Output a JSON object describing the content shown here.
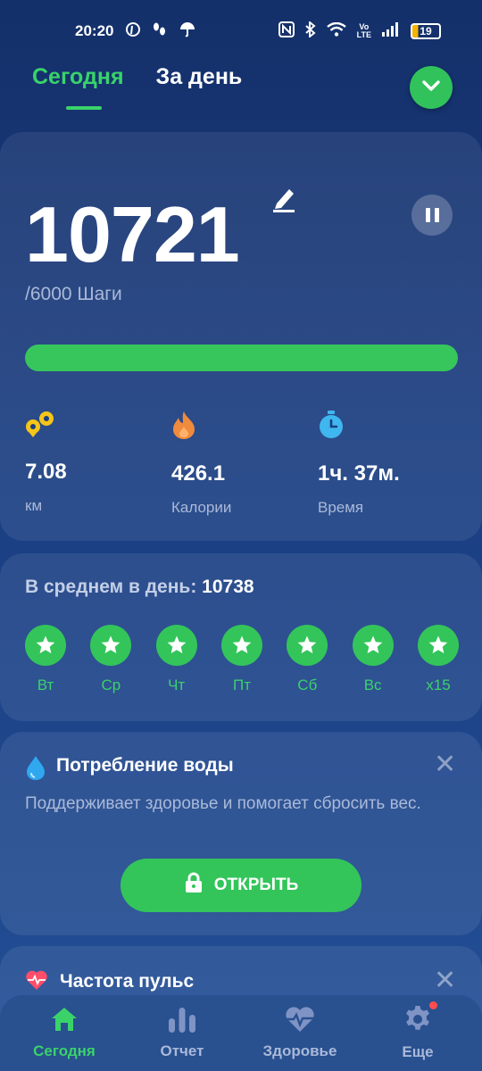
{
  "status_bar": {
    "time": "20:20",
    "lte_top": "Vo",
    "lte_bottom": "LTE",
    "battery": "19"
  },
  "tabs": [
    {
      "label": "Сегодня",
      "active": true
    },
    {
      "label": "За день",
      "active": false
    }
  ],
  "steps": {
    "value": "10721",
    "goal_text": "/6000 Шаги",
    "progress_fraction": 1.0
  },
  "stats": [
    {
      "value": "7.08",
      "label": "км",
      "icon": "route-icon",
      "color": "#f5c518"
    },
    {
      "value": "426.1",
      "label": "Калории",
      "icon": "flame-icon",
      "color": "#f08a3c"
    },
    {
      "value": "1ч. 37м.",
      "label": "Время",
      "icon": "stopwatch-icon",
      "color": "#3fb6ef"
    }
  ],
  "average": {
    "label": "В среднем в день: ",
    "value": "10738",
    "days": [
      "Вт",
      "Ср",
      "Чт",
      "Пт",
      "Сб",
      "Вс",
      "x15"
    ]
  },
  "water": {
    "title": "Потребление воды",
    "description": "Поддерживает здоровье и помогает сбросить вес.",
    "button_label": "ОТКРЫТЬ"
  },
  "pulse": {
    "title": "Частота пульс"
  },
  "nav": [
    {
      "label": "Сегодня",
      "icon": "home-icon",
      "active": true
    },
    {
      "label": "Отчет",
      "icon": "bar-chart-icon",
      "active": false
    },
    {
      "label": "Здоровье",
      "icon": "heart-pulse-icon",
      "active": false
    },
    {
      "label": "Еще",
      "icon": "gear-icon",
      "active": false
    }
  ],
  "colors": {
    "accent": "#33c55a",
    "background": "#1b3e82",
    "muted_text": "#aab9d9"
  }
}
